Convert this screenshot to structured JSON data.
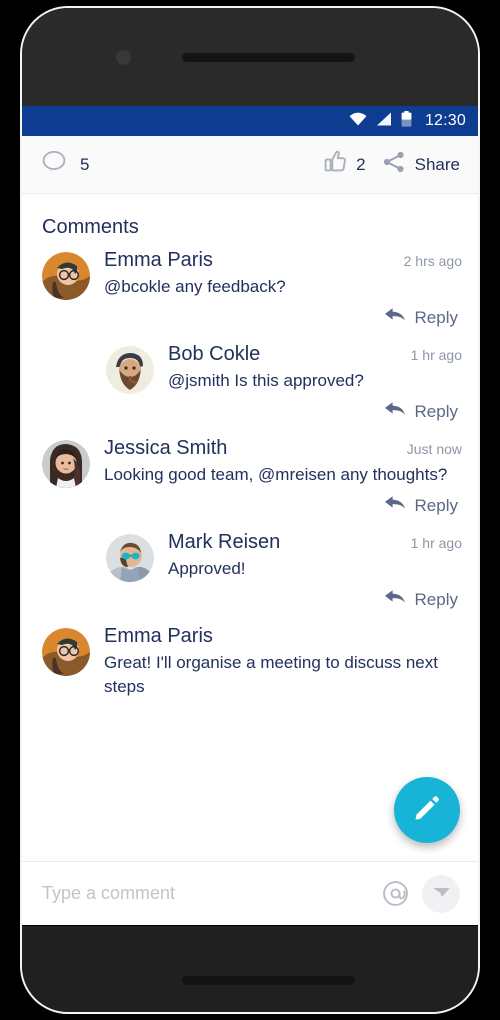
{
  "status_bar": {
    "time": "12:30",
    "wifi_icon": "wifi-icon",
    "signal_icon": "cellular-signal-icon",
    "battery_icon": "battery-icon",
    "background_color": "#0d3c91"
  },
  "action_bar": {
    "comment_icon": "comment-bubble-icon",
    "comment_count": "5",
    "like_icon": "thumbs-up-icon",
    "like_count": "2",
    "share_icon": "share-icon",
    "share_label": "Share"
  },
  "comments_section": {
    "title": "Comments",
    "reply_label": "Reply",
    "items": [
      {
        "author": "Emma Paris",
        "timestamp": "2 hrs ago",
        "text": "@bcokle  any feedback?",
        "indented": false,
        "avatar": "avatar-emma-paris"
      },
      {
        "author": "Bob Cokle",
        "timestamp": "1 hr ago",
        "text": "@jsmith  Is this approved?",
        "indented": true,
        "avatar": "avatar-bob-cokle"
      },
      {
        "author": "Jessica Smith",
        "timestamp": "Just now",
        "text": "Looking good team, @mreisen any thoughts?",
        "indented": false,
        "avatar": "avatar-jessica-smith"
      },
      {
        "author": "Mark Reisen",
        "timestamp": "1 hr ago",
        "text": "Approved!",
        "indented": true,
        "avatar": "avatar-mark-reisen"
      },
      {
        "author": "Emma Paris",
        "timestamp": "",
        "text": "Great! I'll organise a meeting to discuss next steps",
        "indented": false,
        "avatar": "avatar-emma-paris"
      }
    ]
  },
  "fab": {
    "icon": "pencil-icon",
    "color": "#17b4d8"
  },
  "composer": {
    "placeholder": "Type a comment",
    "value": "",
    "mention_icon": "at-mention-icon",
    "send_icon": "send-icon"
  },
  "nav_bar": {
    "back_icon": "back-triangle-icon",
    "home_icon": "home-circle-icon",
    "recents_icon": "recents-square-icon"
  },
  "device": {
    "camera_icon": "front-camera-icon",
    "speaker_icon": "earpiece-speaker-icon"
  }
}
